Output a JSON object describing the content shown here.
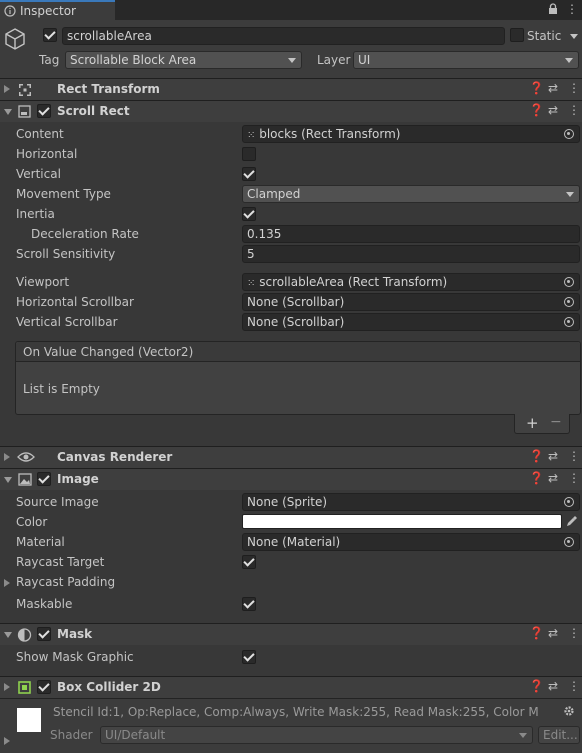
{
  "tab": {
    "label": "Inspector"
  },
  "object": {
    "name": "scrollableArea",
    "static_label": "Static",
    "tag_label": "Tag",
    "tag_value": "Scrollable Block Area",
    "layer_label": "Layer",
    "layer_value": "UI"
  },
  "components": {
    "rect_transform": {
      "title": "Rect Transform"
    },
    "scroll_rect": {
      "title": "Scroll Rect",
      "content_label": "Content",
      "content_value": "blocks (Rect Transform)",
      "horizontal_label": "Horizontal",
      "vertical_label": "Vertical",
      "movement_type_label": "Movement Type",
      "movement_type_value": "Clamped",
      "inertia_label": "Inertia",
      "deceleration_label": "Deceleration Rate",
      "deceleration_value": "0.135",
      "scroll_sensitivity_label": "Scroll Sensitivity",
      "scroll_sensitivity_value": "5",
      "viewport_label": "Viewport",
      "viewport_value": "scrollableArea (Rect Transform)",
      "hscroll_label": "Horizontal Scrollbar",
      "hscroll_value": "None (Scrollbar)",
      "vscroll_label": "Vertical Scrollbar",
      "vscroll_value": "None (Scrollbar)",
      "event_title": "On Value Changed (Vector2)",
      "event_empty": "List is Empty",
      "add_label": "+",
      "remove_label": "−"
    },
    "canvas_renderer": {
      "title": "Canvas Renderer"
    },
    "image": {
      "title": "Image",
      "source_label": "Source Image",
      "source_value": "None (Sprite)",
      "color_label": "Color",
      "color_value": "#ffffff",
      "material_label": "Material",
      "material_value": "None (Material)",
      "raycast_target_label": "Raycast Target",
      "raycast_padding_label": "Raycast Padding",
      "maskable_label": "Maskable"
    },
    "mask": {
      "title": "Mask",
      "show_graphic_label": "Show Mask Graphic"
    },
    "box_collider": {
      "title": "Box Collider 2D"
    }
  },
  "material_preview": {
    "info": "Stencil Id:1, Op:Replace, Comp:Always, Write Mask:255, Read Mask:255, Color M",
    "shader_label": "Shader",
    "shader_value": "UI/Default",
    "edit_label": "Edit..."
  },
  "colors": {
    "accent": "#3a79bb",
    "bg": "#383838",
    "header": "#3e3e3e"
  }
}
